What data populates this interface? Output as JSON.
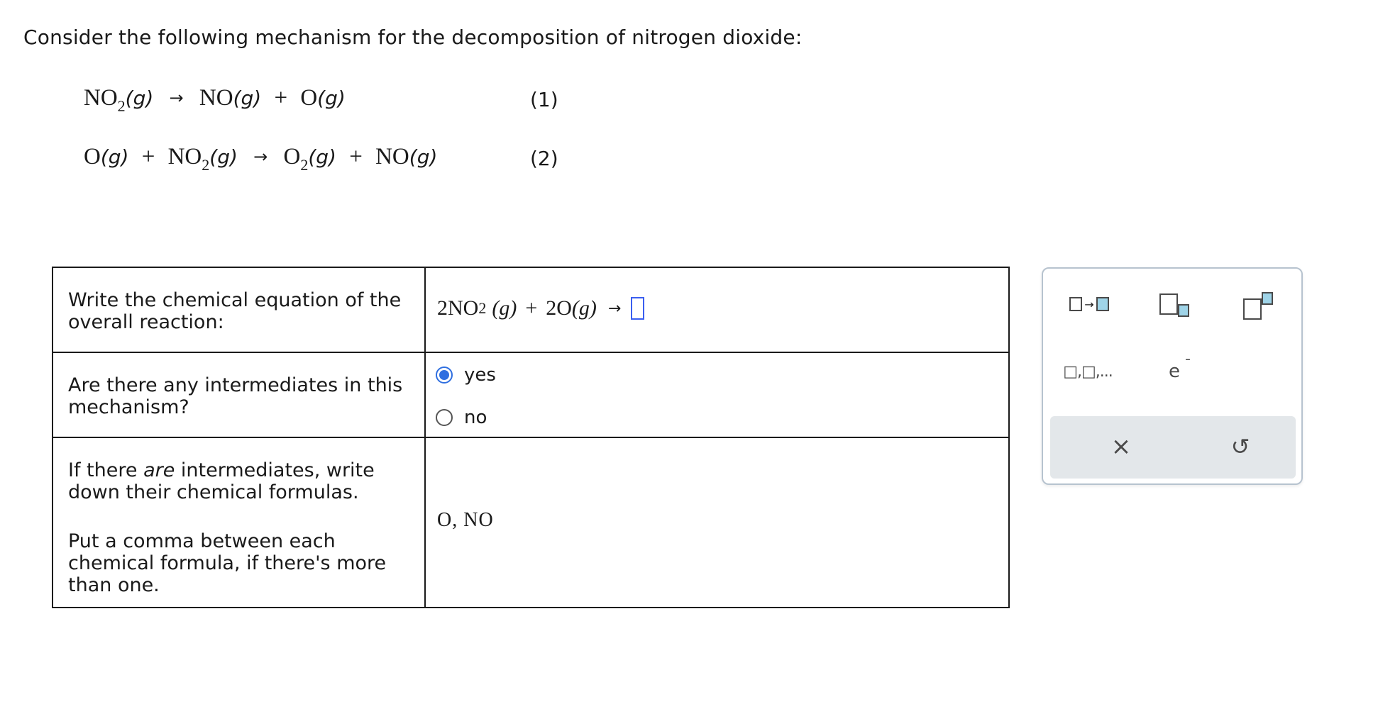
{
  "intro": "Consider the following mechanism for the decomposition of nitrogen dioxide:",
  "mechanism": {
    "step1": {
      "reactant": "NO",
      "reactant_sub": "2",
      "state": "(g)",
      "arrow": "→",
      "prod1": "NO",
      "prod2": "O",
      "number": "(1)"
    },
    "step2": {
      "r1": "O",
      "r2": "NO",
      "r2_sub": "2",
      "state": "(g)",
      "arrow": "→",
      "p1": "O",
      "p1_sub": "2",
      "p2": "NO",
      "number": "(2)"
    },
    "plus": "+"
  },
  "questions": {
    "q1": {
      "label": "Write the chemical equation of the overall reaction:",
      "eq_coef1": "2NO",
      "eq_sub": "2",
      "eq_state": "(g)",
      "eq_plus": "+",
      "eq_coef2": "2O",
      "arrow": "→"
    },
    "q2": {
      "label": "Are there any intermediates in this mechanism?",
      "options": [
        "yes",
        "no"
      ],
      "selected": "yes"
    },
    "q3": {
      "label_pre": "If there ",
      "label_em": "are",
      "label_post": " intermediates, write down their chemical formulas.",
      "label2": "Put a comma between each chemical formula, if there's more than one.",
      "answer": "O, NO"
    }
  },
  "palette": {
    "multi_label": "□,□,...",
    "electron": "e",
    "clear": "×",
    "undo": "↺",
    "accent": "#9fd4e8"
  }
}
